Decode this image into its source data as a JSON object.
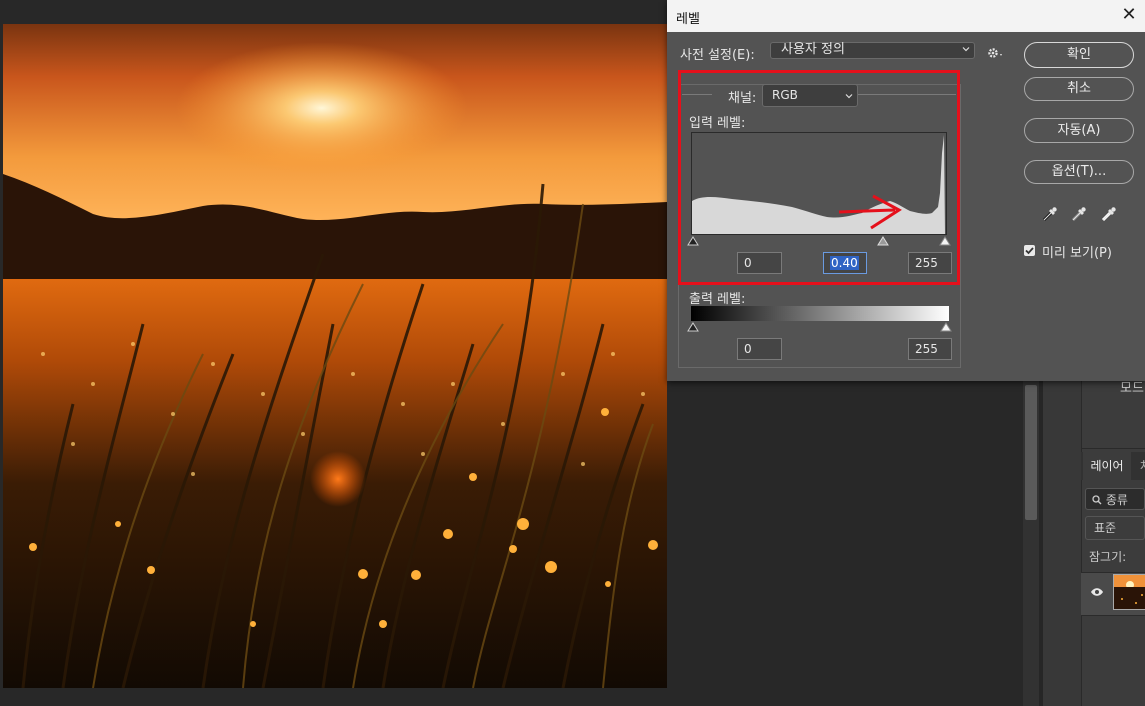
{
  "dialog": {
    "title": "레벨",
    "close": "✕",
    "preset_label": "사전 설정(E):",
    "preset_value": "사용자 정의",
    "channel_label": "채널:",
    "channel_value": "RGB",
    "input_levels_label": "입력 레벨:",
    "input_black": "0",
    "input_gamma": "0.40",
    "input_white": "255",
    "output_levels_label": "출력 레벨:",
    "output_black": "0",
    "output_white": "255",
    "buttons": {
      "ok": "확인",
      "cancel": "취소",
      "auto": "자동(A)",
      "options": "옵션(T)..."
    },
    "preview_label": "미리 보기(P)",
    "preview_checked": true
  },
  "layers_panel": {
    "mode_label": "모드",
    "tab_layers": "레이어",
    "tab_other": "차",
    "kind_filter": "종류",
    "blend_mode": "표준",
    "lock_label": "잠그기:"
  },
  "icons": {
    "gear": "gear-icon",
    "eyedropper_black": "eyedropper-black-icon",
    "eyedropper_gray": "eyedropper-gray-icon",
    "eyedropper_white": "eyedropper-white-icon",
    "eye": "eye-icon",
    "search": "search-icon"
  },
  "colors": {
    "highlight_box": "#e5101b",
    "annotation_arrow": "#e5101b",
    "dialog_bg": "#535353"
  }
}
